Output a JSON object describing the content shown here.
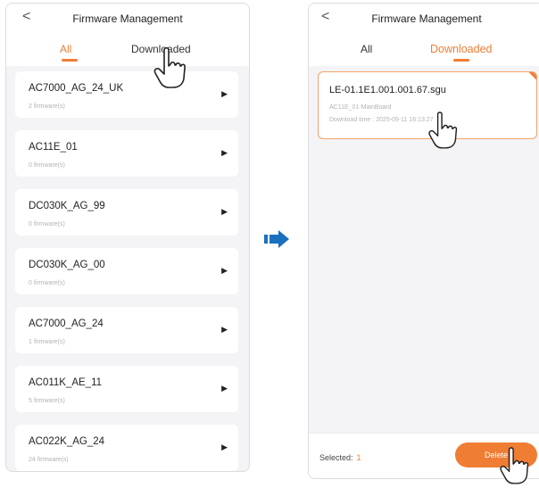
{
  "left_screen": {
    "header": {
      "back": "<",
      "title": "Firmware Management"
    },
    "tabs": [
      {
        "label": "All",
        "active": true
      },
      {
        "label": "Downloaded",
        "active": false
      }
    ],
    "items": [
      {
        "name": "AC7000_AG_24_UK",
        "count": "2 firmware(s)"
      },
      {
        "name": "AC11E_01",
        "count": "0 firmware(s)"
      },
      {
        "name": "DC030K_AG_99",
        "count": "0 firmware(s)"
      },
      {
        "name": "DC030K_AG_00",
        "count": "0 firmware(s)"
      },
      {
        "name": "AC7000_AG_24",
        "count": "1 firmware(s)"
      },
      {
        "name": "AC011K_AE_11",
        "count": "5 firmware(s)"
      },
      {
        "name": "AC022K_AG_24",
        "count": "24 firmware(s)"
      }
    ]
  },
  "right_screen": {
    "header": {
      "back": "<",
      "title": "Firmware Management"
    },
    "tabs": [
      {
        "label": "All",
        "active": false
      },
      {
        "label": "Downloaded",
        "active": true
      }
    ],
    "firmware": {
      "file": "LE-01.1E1.001.001.67.sgu",
      "board": "AC11E_01-MainBoard",
      "download_time": "Download time : 2025-09-11 16:13:27"
    },
    "footer": {
      "selected_label": "Selected:",
      "selected_count": "1",
      "delete_label": "Delete"
    }
  },
  "colors": {
    "accent": "#ef7d34",
    "transfer_arrow": "#1b6fbf"
  }
}
